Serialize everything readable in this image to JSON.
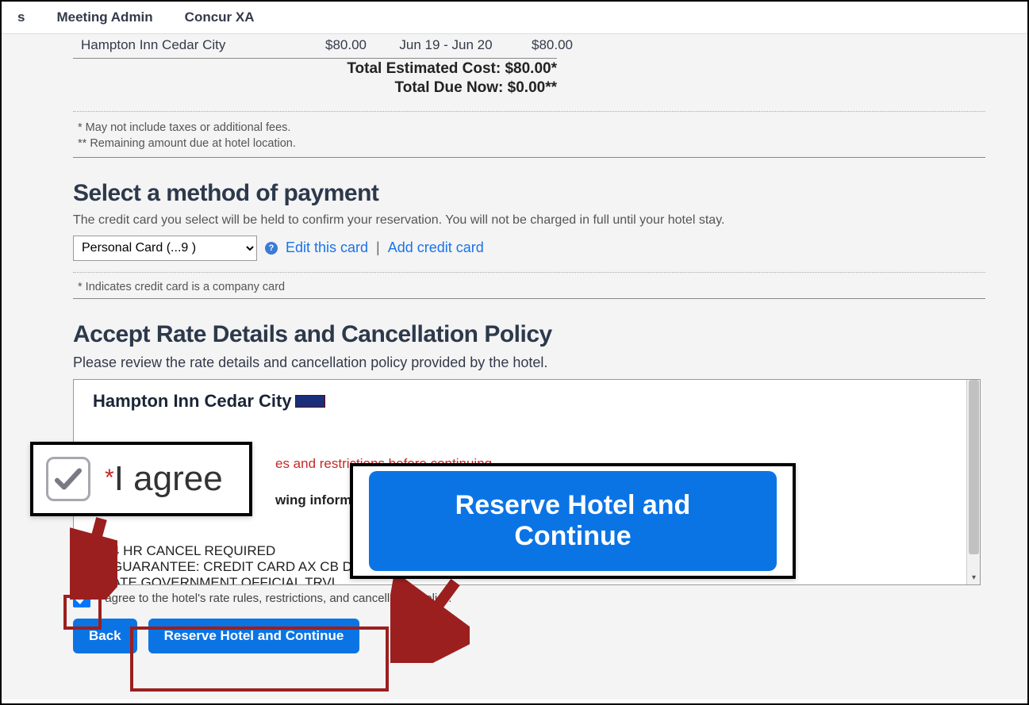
{
  "nav": {
    "partial_left": "s",
    "meeting_admin": "Meeting Admin",
    "concur_xa": "Concur XA"
  },
  "summary": {
    "hotel_name": "Hampton Inn Cedar City",
    "rate": "$80.00",
    "dates": "Jun 19 - Jun 20",
    "subtotal": "$80.00"
  },
  "totals": {
    "estimated_label": "Total Estimated Cost: $80.00*",
    "due_label": "Total Due Now: $0.00**"
  },
  "footnotes": {
    "f1": "* May not include taxes or additional fees.",
    "f2": "** Remaining amount due at hotel location."
  },
  "payment": {
    "heading": "Select a method of payment",
    "sub": "The credit card you select will be held to confirm your reservation. You will not be charged in full until your hotel stay.",
    "card_option": "Personal Card (...9       )",
    "edit_link": "Edit this card",
    "add_link": "Add credit card",
    "cc_note": "* Indicates credit card is a company card"
  },
  "policy": {
    "heading": "Accept Rate Details and Cancellation Policy",
    "sub": "Please review the rate details and cancellation policy provided by the hotel.",
    "hotel_name": "Hampton Inn Cedar City",
    "warn_frag": "es and restrictions before continuing.",
    "info_frag": "wing information:",
    "l1": "4 HR CANCEL REQUIRED",
    "l2": "GUARANTEE: CREDIT CARD AX CB DC",
    "l3": "ATE GOVERNMENT OFFICIAL TRVL"
  },
  "agree": {
    "label": "I agree to the hotel's rate rules, restrictions, and cancellation policy.",
    "callout_label": "I agree"
  },
  "buttons": {
    "back": "Back",
    "reserve": "Reserve Hotel and Continue",
    "reserve_big": "Reserve Hotel and Continue"
  }
}
